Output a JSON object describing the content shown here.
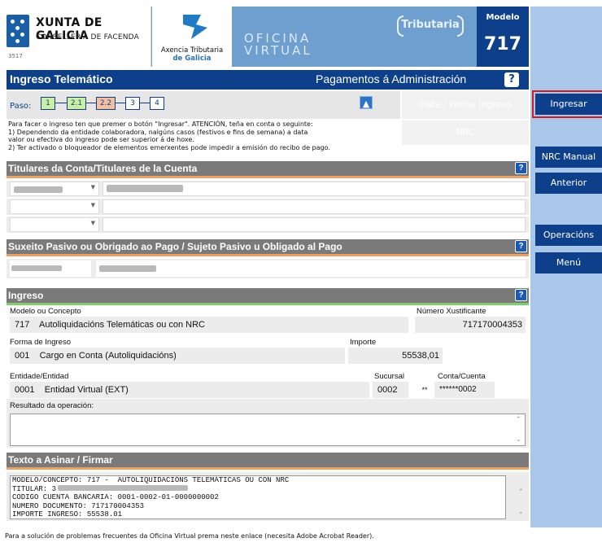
{
  "header": {
    "xunta_title": "XUNTA DE GALICIA",
    "xunta_subtitle": "CONSELLERÍA DE FACENDA",
    "xunta_code": "3517",
    "atriga_line1": "Axencia Tributaria",
    "atriga_line2": "de Galicia",
    "oficina_line1": "OFICINA",
    "oficina_line2": "VIRTUAL",
    "tributaria": "Tributaria",
    "modelo_label": "Modelo",
    "modelo_num": "717"
  },
  "sidebar": {
    "ingresar": "Ingresar",
    "nrc_manual": "NRC Manual",
    "anterior": "Anterior",
    "operacions": "Operacións",
    "menu": "Menú"
  },
  "titlebar": {
    "left": "Ingreso Telemático",
    "right": "Pagamentos á Administración",
    "help": "?"
  },
  "steps": {
    "label": "Paso:",
    "items": [
      "1",
      "2.1",
      "2.2",
      "3",
      "4"
    ]
  },
  "date_label": "Data / Fecha Ingreso",
  "nrc_label": "NRC",
  "instructions": {
    "line1": "Para facer o ingreso ten que premer o botón \"Ingresar\". ATENCIÓN, teña en conta o seguinte:",
    "line2": "1) Dependendo da entidade colaboradora, nalgúns casos (festivos e fins de semana) a data",
    "line3": "valor ou efectiva do ingreso pode ser superior á de hoxe.",
    "line4": "2) Ter activado o bloqueador de elementos emerxentes pode impedir a emisión do recibo de pago."
  },
  "sections": {
    "titulares": "Titulares da Conta/Titulares de la Cuenta",
    "suxeito": "Suxeito Pasivo ou Obrigado ao Pago / Sujeto Pasivo u Obligado al Pago",
    "ingreso": "Ingreso",
    "texto": "Texto a Asinar / Firmar",
    "help": "?"
  },
  "ingreso": {
    "modelo_label": "Modelo ou Concepto",
    "modelo_code": "717",
    "modelo_desc": "Autoliquidacións Telemáticas ou con NRC",
    "xustificante_label": "Número Xustificante",
    "xustificante": "717170004353",
    "forma_label": "Forma de Ingreso",
    "forma_code": "001",
    "forma_desc": "Cargo en Conta (Autoliquidacións)",
    "importe_label": "Importe",
    "importe": "55538,01",
    "entidade_label": "Entidade/Entidad",
    "entidade_code": "0001",
    "entidade_desc": "Entidad Virtual (EXT)",
    "sucursal_label": "Sucursal",
    "sucursal": "0002",
    "dc": "**",
    "conta_label": "Conta/Cuenta",
    "conta": "******0002",
    "resultado_label": "Resultado da operación:"
  },
  "sign_text": {
    "l1": "MODELO/CONCEPTO: 717 -  AUTOLIQUIDACIÓNS TELEMÁTICAS OU CON NRC",
    "l2": "TITULAR: 3",
    "l3": "CODIGO CUENTA BANCARIA: 0001-0002-01-0000000002",
    "l4": "NUMERO DOCUMENTO: 717170004353",
    "l5": "IMPORTE INGRESO: 55538.01"
  },
  "footer": "Para a solución de problemas frecuentes da Oficina Virtual prema neste enlace (necesita Adobe Acrobat Reader)."
}
